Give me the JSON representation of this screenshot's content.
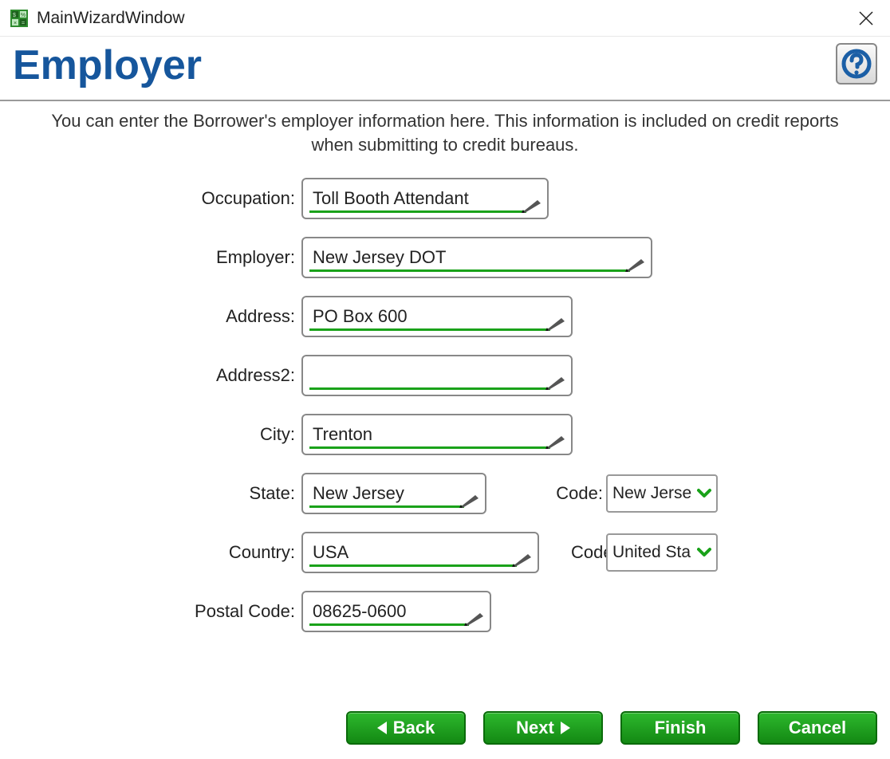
{
  "window": {
    "title": "MainWizardWindow"
  },
  "header": {
    "page_title": "Employer",
    "instructions": "You can enter the Borrower's employer information here. This information is included on credit reports when submitting to credit bureaus."
  },
  "labels": {
    "occupation": "Occupation:",
    "employer": "Employer:",
    "address": "Address:",
    "address2": "Address2:",
    "city": "City:",
    "state": "State:",
    "state_code": "Code:",
    "country": "Country:",
    "country_code": "Code:",
    "postal": "Postal Code:"
  },
  "fields": {
    "occupation": "Toll Booth Attendant",
    "employer": "New Jersey DOT",
    "address": "PO Box 600",
    "address2": "",
    "city": "Trenton",
    "state": "New Jersey",
    "state_code_display": "New Jerse",
    "country": "USA",
    "country_code_display": "United Sta",
    "postal": "08625-0600"
  },
  "buttons": {
    "back": "Back",
    "next": "Next",
    "finish": "Finish",
    "cancel": "Cancel"
  }
}
